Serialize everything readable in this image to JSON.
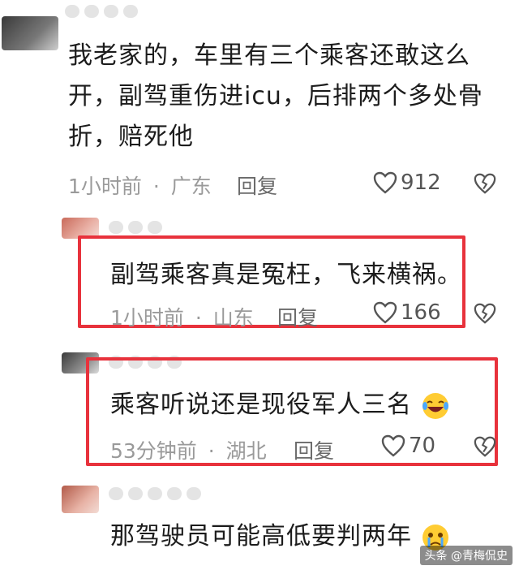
{
  "comments": [
    {
      "text_lines": [
        "我老家的，车里有三个乘客还敢这么",
        "开，副驾重伤进icu，后排两个多处骨",
        "折，赔死他"
      ],
      "time": "1小时前",
      "location": "广东",
      "reply_label": "回复",
      "likes": "912"
    },
    {
      "text": "副驾乘客真是冤枉，飞来横祸。",
      "time": "1小时前",
      "location": "山东",
      "reply_label": "回复",
      "likes": "166"
    },
    {
      "text": "乘客听说还是现役军人三名",
      "emoji": "laughing-crying-emoji",
      "time": "53分钟前",
      "location": "湖北",
      "reply_label": "回复",
      "likes": "70"
    },
    {
      "text": "那驾驶员可能高低要判两年",
      "emoji": "crying-emoji"
    }
  ],
  "separator": "·",
  "watermark": "头条 @青梅侃史",
  "colors": {
    "highlight_box": "#e8323c",
    "meta_text": "#9a9a9a"
  }
}
